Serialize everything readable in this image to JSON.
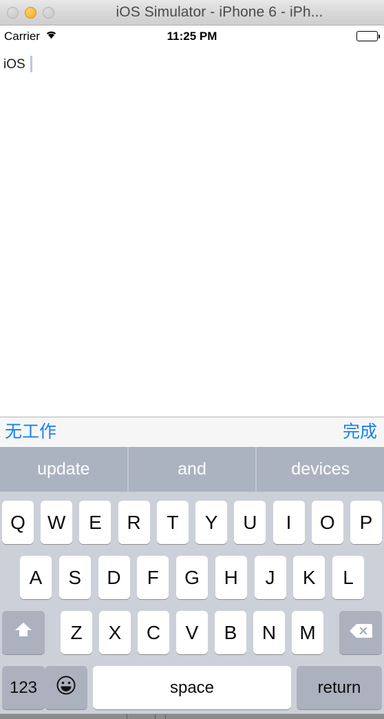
{
  "window": {
    "title": "iOS Simulator - iPhone 6 - iPh...",
    "buttons": {
      "close": "close-button",
      "minimize": "minimize-button",
      "zoom": "zoom-button"
    }
  },
  "status_bar": {
    "carrier": "Carrier",
    "wifi_icon": "wifi-icon",
    "time": "11:25 PM",
    "battery_icon": "battery-full-icon"
  },
  "content": {
    "text_value": "iOS",
    "placeholder": "",
    "caret_color": "#b9c6ea"
  },
  "accessory_bar": {
    "left_label": "无工作",
    "right_label": "完成",
    "tint_color": "#1482f0"
  },
  "predictions": {
    "items": [
      "update",
      "and",
      "devices"
    ],
    "background": "#acb3c0",
    "text_color": "#ffffff"
  },
  "keyboard": {
    "row1": [
      "Q",
      "W",
      "E",
      "R",
      "T",
      "Y",
      "U",
      "I",
      "O",
      "P"
    ],
    "row2": [
      "A",
      "S",
      "D",
      "F",
      "G",
      "H",
      "J",
      "K",
      "L"
    ],
    "row3": [
      "Z",
      "X",
      "C",
      "V",
      "B",
      "N",
      "M"
    ],
    "shift_icon": "shift-arrow-icon",
    "delete_icon": "backspace-delete-icon",
    "numbers_label": "123",
    "emoji_icon": "smiley-emoji-icon",
    "space_label": "space",
    "return_label": "return",
    "background": "#ccd0d8",
    "key_color": "#ffffff",
    "modifier_key_color": "#abb1bd"
  }
}
